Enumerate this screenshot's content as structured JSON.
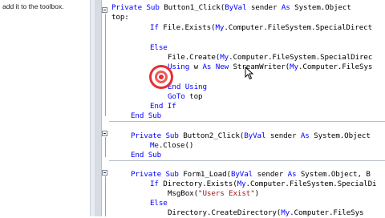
{
  "toolbox_hint": "add it to the toolbox.",
  "code": [
    {
      "segs": [
        [
          "kw",
          "Private Sub "
        ],
        [
          "",
          "Button1_Click("
        ],
        [
          "kw",
          "ByVal "
        ],
        [
          "",
          "sender "
        ],
        [
          "kw",
          "As "
        ],
        [
          "",
          "System.Object"
        ]
      ]
    },
    {
      "segs": [
        [
          "",
          "top:"
        ]
      ]
    },
    {
      "segs": [
        [
          "kw",
          "If "
        ],
        [
          "",
          "File.Exists("
        ],
        [
          "kw",
          "My"
        ],
        [
          "",
          ".Computer.FileSystem.SpecialDirect"
        ]
      ]
    },
    {
      "segs": [
        [
          "kw",
          "Else"
        ]
      ]
    },
    {
      "segs": [
        [
          "",
          "File.Create("
        ],
        [
          "kw",
          "My"
        ],
        [
          "",
          ".Computer.FileSystem.SpecialDirec"
        ]
      ]
    },
    {
      "segs": [
        [
          "kw",
          "Using "
        ],
        [
          "",
          "w "
        ],
        [
          "kw",
          "As New "
        ],
        [
          "",
          "StreamWriter("
        ],
        [
          "kw",
          "My"
        ],
        [
          "",
          ".Computer.FileSys"
        ]
      ]
    },
    {
      "segs": [
        [
          "kw",
          "End Using"
        ]
      ]
    },
    {
      "segs": [
        [
          "kw",
          "GoTo "
        ],
        [
          "",
          "top"
        ]
      ]
    },
    {
      "segs": [
        [
          "kw",
          "End If"
        ]
      ]
    },
    {
      "segs": [
        [
          "kw",
          "End Sub"
        ]
      ]
    },
    {
      "segs": [
        [
          "kw",
          "Private Sub "
        ],
        [
          "",
          "Button2_Click("
        ],
        [
          "kw",
          "ByVal "
        ],
        [
          "",
          "sender "
        ],
        [
          "kw",
          "As "
        ],
        [
          "",
          "System.Object"
        ]
      ]
    },
    {
      "segs": [
        [
          "kw",
          "Me"
        ],
        [
          "",
          ".Close()"
        ]
      ]
    },
    {
      "segs": [
        [
          "kw",
          "End Sub"
        ]
      ]
    },
    {
      "segs": [
        [
          "kw",
          "Private Sub "
        ],
        [
          "",
          "Form1_Load("
        ],
        [
          "kw",
          "ByVal "
        ],
        [
          "",
          "sender "
        ],
        [
          "kw",
          "As "
        ],
        [
          "",
          "System.Object, B"
        ]
      ]
    },
    {
      "segs": [
        [
          "kw",
          "If "
        ],
        [
          "",
          "Directory.Exists("
        ],
        [
          "kw",
          "My"
        ],
        [
          "",
          ".Computer.FileSystem.SpecialDi"
        ]
      ]
    },
    {
      "segs": [
        [
          "",
          "MsgBox("
        ],
        [
          "str",
          "\"Users Exist\""
        ],
        [
          "",
          ")"
        ]
      ]
    },
    {
      "segs": [
        [
          "kw",
          "Else"
        ]
      ]
    },
    {
      "segs": [
        [
          "",
          "Directory.CreateDirectory("
        ],
        [
          "kw",
          "My"
        ],
        [
          "",
          ".Computer.FileSys"
        ]
      ]
    }
  ]
}
